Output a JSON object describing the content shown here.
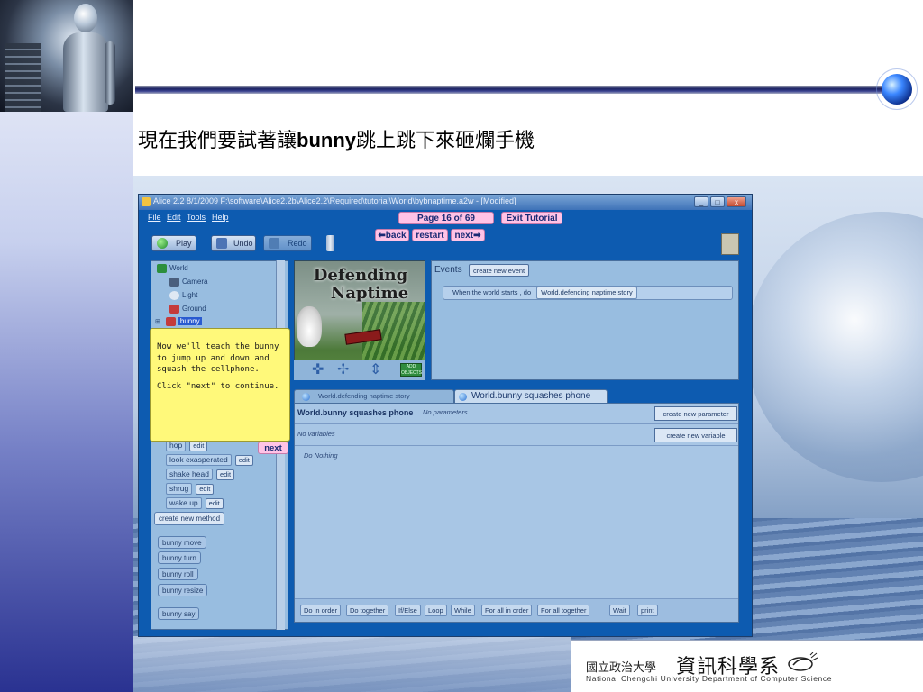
{
  "slide": {
    "title_before": "現在我們要試著讓",
    "title_bold": "bunny",
    "title_after": "跳上跳下來砸爛手機",
    "logo_university": "國立政治大學",
    "logo_department": "資訊科學系",
    "logo_english": "National Chengchi University Department of Computer Science"
  },
  "window": {
    "title": "Alice 2.2 8/1/2009 F:\\software\\Alice2.2b\\Alice2.2\\Required\\tutorial\\World\\bybnaptime.a2w - [Modified]",
    "controls": {
      "minimize": "_",
      "maximize": "□",
      "close": "x"
    }
  },
  "menu": [
    "File",
    "Edit",
    "Tools",
    "Help"
  ],
  "tutorial": {
    "page_label": "Page 16 of 69",
    "exit_label": "Exit Tutorial",
    "back_label": "back",
    "restart_label": "restart",
    "next_label": "next",
    "tooltip_line1": "Now we'll teach the bunny to jump up and down and squash the cellphone.",
    "tooltip_line2": "Click \"next\" to continue.",
    "tooltip_next": "next"
  },
  "toolbar": {
    "play": "Play",
    "undo": "Undo",
    "redo": "Redo"
  },
  "tree": {
    "world": "World",
    "camera": "Camera",
    "light": "Light",
    "ground": "Ground",
    "bunny": "bunny"
  },
  "methods": [
    {
      "name": "hop",
      "edit": "edit"
    },
    {
      "name": "look exasperated",
      "edit": "edit"
    },
    {
      "name": "shake head",
      "edit": "edit"
    },
    {
      "name": "shrug",
      "edit": "edit"
    },
    {
      "name": "wake up",
      "edit": "edit"
    }
  ],
  "create_new_method": "create new method",
  "built_in_methods": [
    "bunny  move",
    "bunny  turn",
    "bunny  roll",
    "bunny  resize",
    "bunny  say"
  ],
  "scene": {
    "title_line1": "Defending",
    "title_line2": "Naptime",
    "add_objects": "ADD OBJECTS"
  },
  "events": {
    "label": "Events",
    "create_button": "create new event",
    "trigger": "When the world starts , do",
    "target": "World.defending naptime story"
  },
  "tabs": [
    "World.defending naptime story",
    "World.bunny squashes phone"
  ],
  "editor": {
    "method_title": "World.bunny squashes phone",
    "params": "No parameters",
    "new_param_button": "create new parameter",
    "no_vars": "No variables",
    "new_var_button": "create new variable",
    "do_nothing": "Do Nothing"
  },
  "controls": [
    "Do in order",
    "Do together",
    "If/Else",
    "Loop",
    "While",
    "For all in order",
    "For all together",
    "Wait",
    "print"
  ],
  "colors": {
    "window_bg": "#0d5bb0",
    "tutorial_pill": "#ffc3e6",
    "tooltip_bg": "#fff97a",
    "panel_bg": "#98bde0"
  }
}
